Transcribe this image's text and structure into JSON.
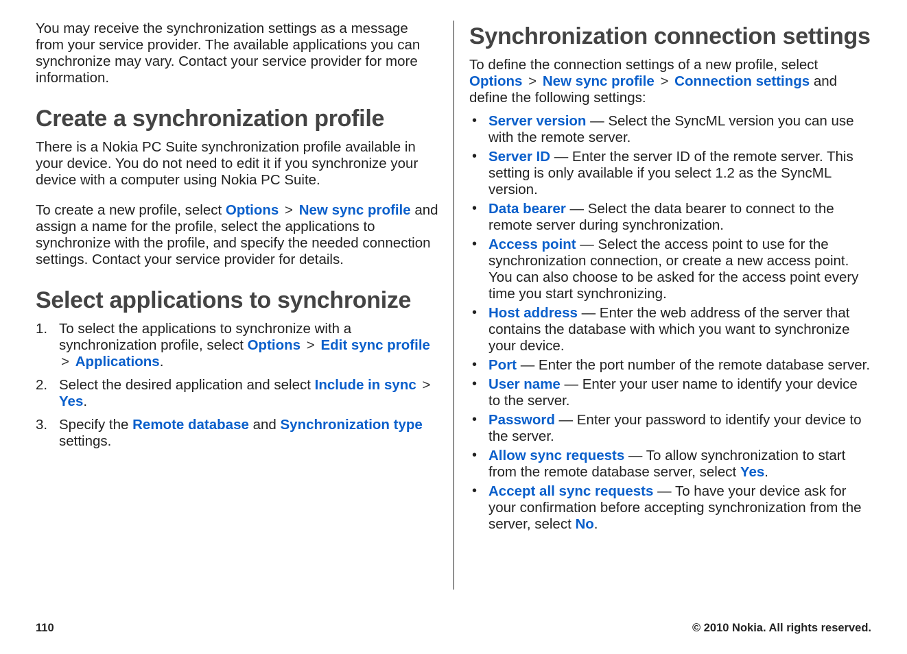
{
  "left": {
    "intro": "You may receive the synchronization settings as a message from your service provider. The available applications you can synchronize may vary. Contact your service provider for more information.",
    "h_create": "Create a synchronization profile",
    "create_p1": "There is a Nokia PC Suite synchronization profile available in your device. You do not need to edit it if you synchronize your device with a computer using Nokia PC Suite.",
    "create_p2_a": "To create a new profile, select ",
    "create_p2_opt": "Options",
    "create_p2_nsp": "New sync profile",
    "create_p2_b": " and assign a name for the profile, select the applications to synchronize with the profile, and specify the needed connection settings. Contact your service provider for details.",
    "h_select": "Select applications to synchronize",
    "steps": [
      {
        "a": "To select the applications to synchronize with a synchronization profile, select ",
        "opt": "Options",
        "mid1": "Edit sync profile",
        "mid2": "Applications",
        "tail": "."
      },
      {
        "a": "Select the desired application and select ",
        "mid1": "Include in sync",
        "mid2": "Yes",
        "tail": "."
      },
      {
        "a": "Specify the ",
        "mid1": "Remote database",
        "between": " and ",
        "mid2": "Synchronization type",
        "tail": " settings."
      }
    ]
  },
  "right": {
    "h_conn": "Synchronization connection settings",
    "intro_a": "To define the connection settings of a new profile, select ",
    "opt": "Options",
    "nsp": "New sync profile",
    "cs": "Connection settings",
    "intro_b": " and define the following settings:",
    "items": [
      {
        "label": "Server version",
        "text": " — Select the SyncML version you can use with the remote server."
      },
      {
        "label": "Server ID",
        "text": " — Enter the server ID of the remote server. This setting is only available if you select 1.2 as the SyncML version."
      },
      {
        "label": "Data bearer",
        "text": " — Select the data bearer to connect to the remote server during synchronization."
      },
      {
        "label": "Access point",
        "text": " — Select the access point to use for the synchronization connection, or create a new access point. You can also choose to be asked for the access point every time you start synchronizing."
      },
      {
        "label": "Host address",
        "text": " — Enter the web address of the server that contains the database with which you want to synchronize your device."
      },
      {
        "label": "Port",
        "text": " — Enter the port number of the remote database server."
      },
      {
        "label": "User name",
        "text": " — Enter your user name to identify your device to the server."
      },
      {
        "label": "Password",
        "text": " — Enter your password to identify your device to the server."
      },
      {
        "label": "Allow sync requests",
        "text_a": " — To allow synchronization to start from the remote database server, select ",
        "yes": "Yes",
        "text_b": "."
      },
      {
        "label": "Accept all sync requests",
        "text_a": " — To have your device ask for your confirmation before accepting synchronization from the server, select ",
        "no": "No",
        "text_b": "."
      }
    ]
  },
  "footer": {
    "page": "110",
    "copyright": "© 2010 Nokia. All rights reserved."
  },
  "glyphs": {
    "caret": ">"
  }
}
